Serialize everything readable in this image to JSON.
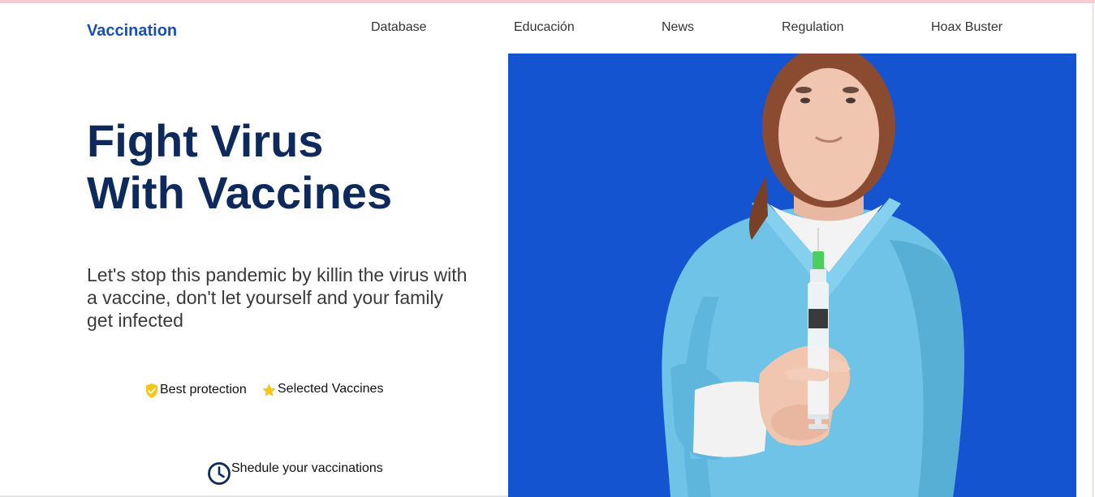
{
  "header": {
    "brand": "Vaccination",
    "nav": [
      "Database",
      "Educación",
      "News",
      "Regulation",
      "Hoax Buster"
    ]
  },
  "hero": {
    "headline_line1": "Fight Virus",
    "headline_line2": "With Vaccines",
    "subtitle": "Let's stop this pandemic by killin the virus with a vaccine, don't let yourself and your family get infected",
    "features": [
      {
        "icon": "shield-check-icon",
        "label": "Best protection"
      },
      {
        "icon": "star-icon",
        "label": "Selected Vaccines"
      }
    ],
    "schedule": {
      "icon": "clock-icon",
      "label": "Shedule your vaccinations"
    },
    "image": {
      "subject": "nurse-holding-syringe"
    }
  },
  "colors": {
    "brand": "#1b4fb8",
    "headline": "#0e2a5c",
    "hero_background": "#1554d1",
    "accent_yellow": "#f5c518",
    "scrubs": "#6fc3e6"
  }
}
